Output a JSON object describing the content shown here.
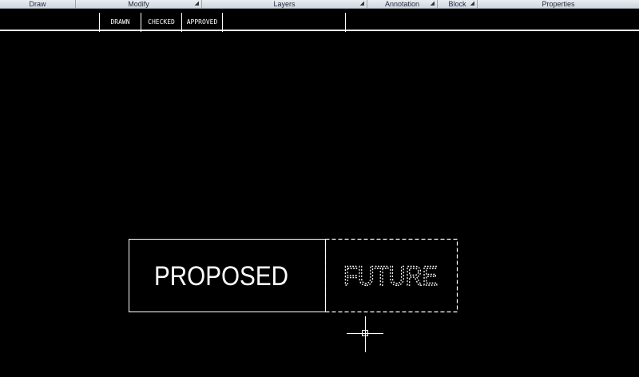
{
  "ribbon": {
    "panels": [
      {
        "label": "Draw",
        "arrow": false
      },
      {
        "label": "Modify",
        "arrow": true
      },
      {
        "label": "Layers",
        "arrow": true
      },
      {
        "label": "Annotation",
        "arrow": true
      },
      {
        "label": "Block",
        "arrow": true
      },
      {
        "label": "Properties",
        "arrow": false
      }
    ]
  },
  "title_block": {
    "drawn_label": "DRAWN",
    "checked_label": "CHECKED",
    "approved_label": "APPROVED"
  },
  "drawing": {
    "proposed_text": "PROPOSED",
    "future_text": "FUTURE"
  },
  "colors": {
    "canvas": "#000000",
    "line": "#ffffff"
  }
}
